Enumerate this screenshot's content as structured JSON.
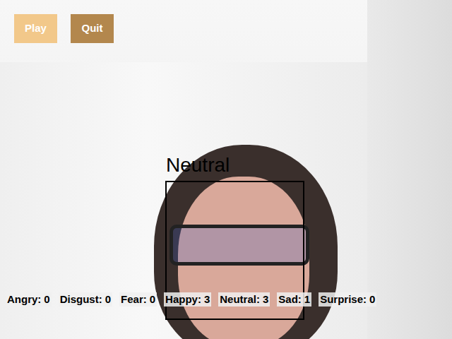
{
  "buttons": [
    {
      "label": "Play",
      "color": "#f2c88a"
    },
    {
      "label": "Quit",
      "color": "#b3874d"
    }
  ],
  "detection": {
    "label": "Neutral"
  },
  "counts": [
    {
      "label": "Angry:",
      "count": "0"
    },
    {
      "label": "Disgust:",
      "count": "0"
    },
    {
      "label": "Fear:",
      "count": "0"
    },
    {
      "label": "Happy:",
      "count": "3"
    },
    {
      "label": "Neutral:",
      "count": "3"
    },
    {
      "label": "Sad:",
      "count": "1"
    },
    {
      "label": "Surprise:",
      "count": "0"
    }
  ]
}
